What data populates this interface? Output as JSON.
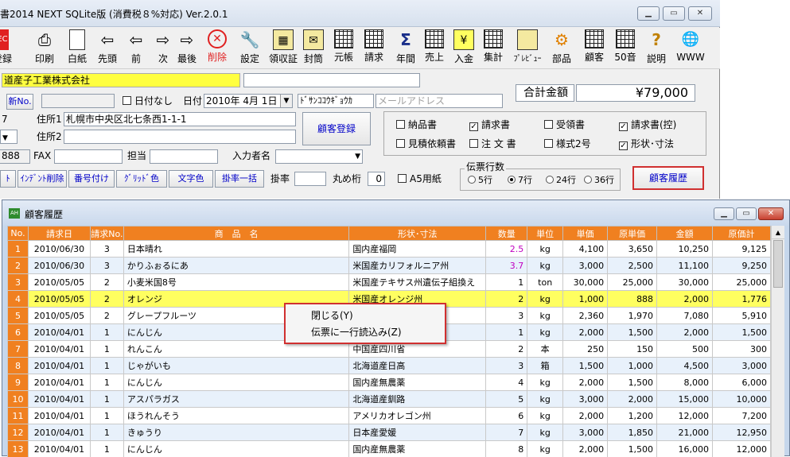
{
  "window": {
    "title": "書2014 NEXT SQLite版 (消費税８%対応) Ver.2.0.1"
  },
  "toolbar": [
    {
      "label": "登録",
      "icon": "register-icon",
      "glyph": "EC"
    },
    {
      "label": "印刷",
      "icon": "printer-icon",
      "glyph": "⎙"
    },
    {
      "label": "白紙",
      "icon": "blank-page-icon",
      "glyph": ""
    },
    {
      "label": "先頭",
      "icon": "first-arrow-icon",
      "glyph": "⇦"
    },
    {
      "label": "前",
      "icon": "prev-arrow-icon",
      "glyph": "⇦"
    },
    {
      "label": "次",
      "icon": "next-arrow-icon",
      "glyph": "⇨"
    },
    {
      "label": "最後",
      "icon": "last-arrow-icon",
      "glyph": "⇨"
    },
    {
      "label": "削除",
      "icon": "delete-icon",
      "glyph": "✕"
    },
    {
      "label": "設定",
      "icon": "wrench-icon",
      "glyph": "🔧"
    },
    {
      "label": "領収証",
      "icon": "receipt-icon",
      "glyph": "▦"
    },
    {
      "label": "封筒",
      "icon": "envelope-icon",
      "glyph": "✉"
    },
    {
      "label": "元帳",
      "icon": "ledger-icon",
      "glyph": ""
    },
    {
      "label": "請求",
      "icon": "invoice-grid-icon",
      "glyph": ""
    },
    {
      "label": "年間",
      "icon": "sigma-icon",
      "glyph": "Σ"
    },
    {
      "label": "売上",
      "icon": "sales-grid-icon",
      "glyph": ""
    },
    {
      "label": "入金",
      "icon": "yen-icon",
      "glyph": "¥"
    },
    {
      "label": "集計",
      "icon": "summary-grid-icon",
      "glyph": ""
    },
    {
      "label": "ﾌﾟﾚﾋﾞｭｰ",
      "icon": "preview-icon",
      "glyph": ""
    },
    {
      "label": "部品",
      "icon": "gear-icon",
      "glyph": "⚙"
    },
    {
      "label": "顧客",
      "icon": "customer-grid-icon",
      "glyph": ""
    },
    {
      "label": "50音",
      "icon": "kana-grid-icon",
      "glyph": ""
    },
    {
      "label": "説明",
      "icon": "help-icon",
      "glyph": "?"
    },
    {
      "label": "WWW",
      "icon": "globe-icon",
      "glyph": "🌐"
    }
  ],
  "form": {
    "company_name": "道産子工業株式会社",
    "new_no_label": "新No.",
    "no_date_label": "日付なし",
    "date_label": "日付",
    "date_value": "2010年 4月 1日",
    "kana_value": "ﾄﾞｻﾝｺｺｳｷﾞｮｳｶ",
    "mail_placeholder": "メールアドレス",
    "total_label": "合計金額",
    "total_value": "¥79,000",
    "zip_fragment": "7",
    "address1_label": "住所1",
    "address1_value": "札幌市中央区北七条西1-1-1",
    "address2_label": "住所2",
    "customer_register": "顧客登録",
    "tel_fragment": "888",
    "fax_label": "FAX",
    "person_label": "担当",
    "entry_name_label": "入力者名",
    "checks": [
      {
        "label": "納品書",
        "checked": false
      },
      {
        "label": "請求書",
        "checked": true
      },
      {
        "label": "受領書",
        "checked": false
      },
      {
        "label": "請求書(控)",
        "checked": true
      },
      {
        "label": "見積依頼書",
        "checked": false
      },
      {
        "label": "注 文 書",
        "checked": false
      },
      {
        "label": "様式2号",
        "checked": false
      },
      {
        "label": "形状･寸法",
        "checked": true
      }
    ],
    "small_buttons": [
      "ﾄ",
      "ｲﾝﾃﾞﾝﾄ削除",
      "番号付け",
      "ｸﾞﾘｯﾄﾞ色",
      "文字色",
      "掛率一括"
    ],
    "rate_label": "掛率",
    "round_label": "丸め桁",
    "round_value": "0",
    "a5_label": "A5用紙",
    "slip_rows_label": "伝票行数",
    "slip_rows": [
      {
        "label": "5行",
        "on": false
      },
      {
        "label": "7行",
        "on": true
      },
      {
        "label": "24行",
        "on": false
      },
      {
        "label": "36行",
        "on": false
      }
    ],
    "history_button": "顧客履歴"
  },
  "history": {
    "title": "顧客履歴",
    "app_badge": "AH",
    "columns": [
      "No.",
      "請求日",
      "請求No.",
      "商　品　名",
      "形状･寸法",
      "数量",
      "単位",
      "単価",
      "原単価",
      "金額",
      "原価計"
    ],
    "rows": [
      [
        "1",
        "2010/06/30",
        "3",
        "日本晴れ",
        "国内産福岡",
        "2.5",
        "kg",
        "4,100",
        "3,650",
        "10,250",
        "9,125"
      ],
      [
        "2",
        "2010/06/30",
        "3",
        "かりふぉるにあ",
        "米国産カリフォルニア州",
        "3.7",
        "kg",
        "3,000",
        "2,500",
        "11,100",
        "9,250"
      ],
      [
        "3",
        "2010/05/05",
        "2",
        "小麦米国8号",
        "米国産テキサス州遺伝子組換え",
        "1",
        "ton",
        "30,000",
        "25,000",
        "30,000",
        "25,000"
      ],
      [
        "4",
        "2010/05/05",
        "2",
        "オレンジ",
        "米国産オレンジ州",
        "2",
        "kg",
        "1,000",
        "888",
        "2,000",
        "1,776"
      ],
      [
        "5",
        "2010/05/05",
        "2",
        "グレープフルーツ",
        "",
        "3",
        "kg",
        "2,360",
        "1,970",
        "7,080",
        "5,910"
      ],
      [
        "6",
        "2010/04/01",
        "1",
        "にんじん",
        "",
        "1",
        "kg",
        "2,000",
        "1,500",
        "2,000",
        "1,500"
      ],
      [
        "7",
        "2010/04/01",
        "1",
        "れんこん",
        "中国産四川省",
        "2",
        "本",
        "250",
        "150",
        "500",
        "300"
      ],
      [
        "8",
        "2010/04/01",
        "1",
        "じゃがいも",
        "北海道産日高",
        "3",
        "箱",
        "1,500",
        "1,000",
        "4,500",
        "3,000"
      ],
      [
        "9",
        "2010/04/01",
        "1",
        "にんじん",
        "国内産無農薬",
        "4",
        "kg",
        "2,000",
        "1,500",
        "8,000",
        "6,000"
      ],
      [
        "10",
        "2010/04/01",
        "1",
        "アスパラガス",
        "北海道産釧路",
        "5",
        "kg",
        "3,000",
        "2,000",
        "15,000",
        "10,000"
      ],
      [
        "11",
        "2010/04/01",
        "1",
        "ほうれんそう",
        "アメリカオレゴン州",
        "6",
        "kg",
        "2,000",
        "1,200",
        "12,000",
        "7,200"
      ],
      [
        "12",
        "2010/04/01",
        "1",
        "きゅうり",
        "日本産愛媛",
        "7",
        "kg",
        "3,000",
        "1,850",
        "21,000",
        "12,950"
      ],
      [
        "13",
        "2010/04/01",
        "1",
        "にんじん",
        "国内産無農薬",
        "8",
        "kg",
        "2,000",
        "1,500",
        "16,000",
        "12,000"
      ]
    ],
    "selected_row": 3,
    "context_menu": [
      "閉じる(Y)",
      "伝票に一行読込み(Z)"
    ]
  }
}
